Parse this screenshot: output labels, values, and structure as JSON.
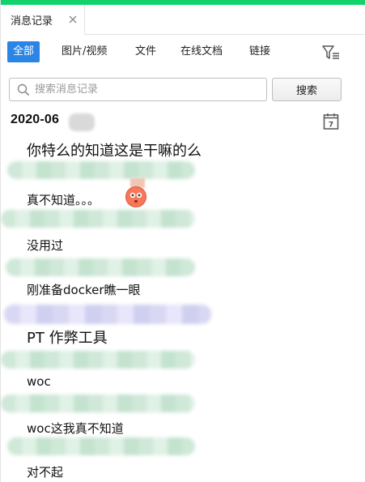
{
  "window": {
    "accent_color": "#12d36b",
    "tab_title": "消息记录",
    "tab_close_icon": "close-icon"
  },
  "filters": {
    "active_color": "#2a85e6",
    "items": [
      {
        "label": "全部",
        "active": true
      },
      {
        "label": "图片/视频",
        "active": false
      },
      {
        "label": "文件",
        "active": false
      },
      {
        "label": "在线文档",
        "active": false
      },
      {
        "label": "链接",
        "active": false
      }
    ],
    "filter_icon": "filter-list-icon"
  },
  "search": {
    "placeholder": "搜索消息记录",
    "value": "",
    "button_label": "搜索",
    "icon": "search-icon"
  },
  "date_header": {
    "label": "2020-06",
    "calendar_icon": "calendar-icon",
    "calendar_day": "7"
  },
  "messages": [
    {
      "text": "你特么的知道这是干嘛的么"
    },
    {
      "text": "真不知道。。。",
      "emoji": "flushed-face-emoji"
    },
    {
      "text": "没用过"
    },
    {
      "text": "刚准备docker瞧一眼"
    },
    {
      "text": "PT 作弊工具"
    },
    {
      "text": "woc"
    },
    {
      "text": "woc这我真不知道"
    },
    {
      "text": "对不起"
    }
  ]
}
